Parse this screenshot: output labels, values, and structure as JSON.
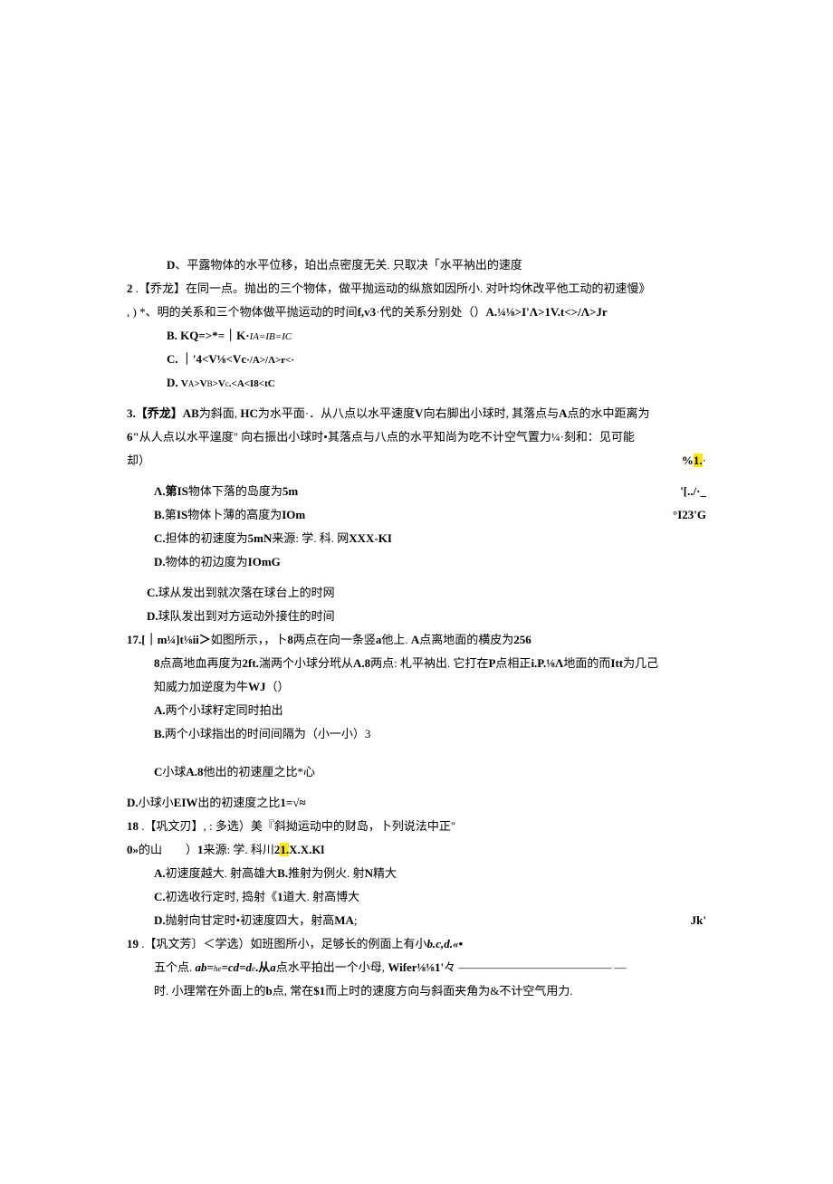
{
  "l1_pre": "D",
  "l1": "、平露物体的水平位移，珀出点密度无关. 只取决「水平衲出的速度",
  "l2_pre": "2",
  "l2": " .【乔龙】在同一点。抛出的三个物体，做平抛运动的纵旅如因所小. 对叶均休改平他工动的初速慢》",
  "l3_a": ", ) *、明的关系和三个物体做平抛运动的时间",
  "l3_b": "f,v3",
  "l3_c": "·代的关系分别处（）",
  "l3_d": "A.¼⅛>I'Λ>1V.t<>/Λ>Jr",
  "l4_a": "B.    KQ=>*=｜K·",
  "l4_b": "IA=IB=IC",
  "l5_a": "C.    ｜'4<V⅛<Vc",
  "l5_b": "·/A>/Λ>r<·",
  "l6_a": "D.    ",
  "l6_b": "V",
  "l6_c": "A",
  "l6_d": ">V",
  "l6_e": "B",
  "l6_f": ">V",
  "l6_g": "c",
  "l6_h": ".<A<I8<tC",
  "l7_a": "3.【乔龙】AB",
  "l7_b": "为斜面, ",
  "l7_c": "HC",
  "l7_d": "为水平面·．从八点以水平速度",
  "l7_e": "V",
  "l7_f": "向右脚出小球时, 其落点与",
  "l7_g": "A",
  "l7_h": "点的水中距离为",
  "l8_a": "6\"",
  "l8_b": "从人点以水平遑度\" 向右振出小球时•其落点与八点的水平知尚为吃不计空气置力¼·刻和：见可能",
  "l9_a": "却）",
  "l9_b": "%",
  "l9_c": "1.",
  "l9_d": "·",
  "l10_a": "Λ.第",
  "l10_b": "IS",
  "l10_c": "物体下落的岛度为",
  "l10_d": "5m",
  "l10_r": "'[../·_",
  "l11_a": "B.",
  "l11_b": "第",
  "l11_c": "IS",
  "l11_d": "物体卜薄的高度为",
  "l11_e": "IOm",
  "l11_r": "°I23'G",
  "l12_a": "C.",
  "l12_b": "担体的初速度为",
  "l12_c": "5mN",
  "l12_d": "来源: 学. 科. 网",
  "l12_e": "XXX-KI",
  "l13_a": "D.",
  "l13_b": "物体的初边度为",
  "l13_c": "IOmG",
  "l14_a": "C.",
  "l14_b": "球从发出到就次落在球台上的时网",
  "l15_a": "D.",
  "l15_b": "球队发出到对方运动外接住的时间",
  "l16_a": "17.[｜m¼]t⅛ii＞",
  "l16_b": "如图所示，，卜",
  "l16_c": "8",
  "l16_d": "两点在向一条竖",
  "l16_e": "a",
  "l16_f": "他上. ",
  "l16_g": "A",
  "l16_h": "点离地面的横皮为",
  "l16_i": "256",
  "l17_a": "8",
  "l17_b": "点高地血再度为",
  "l17_c": "2ft.",
  "l17_d": "湍两个小球分玳从",
  "l17_e": "A.8",
  "l17_f": "两点: 札平衲出. 它打在",
  "l17_g": "P",
  "l17_h": "点相正",
  "l17_i": "i.P.⅛Λ",
  "l17_j": "地面的而",
  "l17_k": "Itt",
  "l17_l": "为几己",
  "l18_a": "知威力加逆度为牛",
  "l18_b": "WJ",
  "l18_c": "（）",
  "l19_a": "A.",
  "l19_b": "两个小球籽定同时拍出",
  "l20_a": "B.",
  "l20_b": "两个小球指出的时间间隔为（小一小）3",
  "l21_a": "C",
  "l21_b": "小球",
  "l21_c": "A.8",
  "l21_d": "他出的初速厘之比*心",
  "l22_a": "D.",
  "l22_b": "小球小",
  "l22_c": "EIW",
  "l22_d": "出的初速度之比",
  "l22_e": "1=√≈",
  "l23_a": "18",
  "l23_b": " .【巩文刃】, : 多选）美『斜拗运动中的财岛，卜列说法中正\"",
  "l24_a": "0»",
  "l24_b": "的山　　）",
  "l24_c": "1",
  "l24_d": "来源: 学. 科川",
  "l24_e": "2",
  "l24_f": "1.",
  "l24_g": "X.X.Kl",
  "l25_a": "A.",
  "l25_b": "初速度越大. 射高雄大",
  "l25_c": "B.",
  "l25_d": "推射为例火. 射",
  "l25_e": "N",
  "l25_f": "精大",
  "l26_a": "C.",
  "l26_b": "初选收行定时, 捣射《",
  "l26_c": "1",
  "l26_d": "道大. 射高博大",
  "l27_a": "D.",
  "l27_b": "抛射向甘定时•初速度四大，射高",
  "l27_c": "MA",
  "l27_d": ";",
  "l27_r": "Jk'",
  "l28_a": "19",
  "l28_b": " .【巩文芳〕＜学选）如班图所小，足够长的例面上有小",
  "l28_c": "b.c,d.«•",
  "l29_a": "五个点. ",
  "l29_b": "ab=",
  "l29_c": "he",
  "l29_d": "=cd=d",
  "l29_e": "e",
  "l29_f": ".从",
  "l29_g": "a",
  "l29_h": "点水平拍出一个小母, ",
  "l29_i": "Wifer⅛⅛1'",
  "l29_j": "々 –––––––––––––––––––––––––– ––",
  "l30_a": "时. 小理常在外面上的",
  "l30_b": "b",
  "l30_c": "点, 常在",
  "l30_d": "$1",
  "l30_e": "而上时的速度方向与斜面夹角为&不计空气用力."
}
